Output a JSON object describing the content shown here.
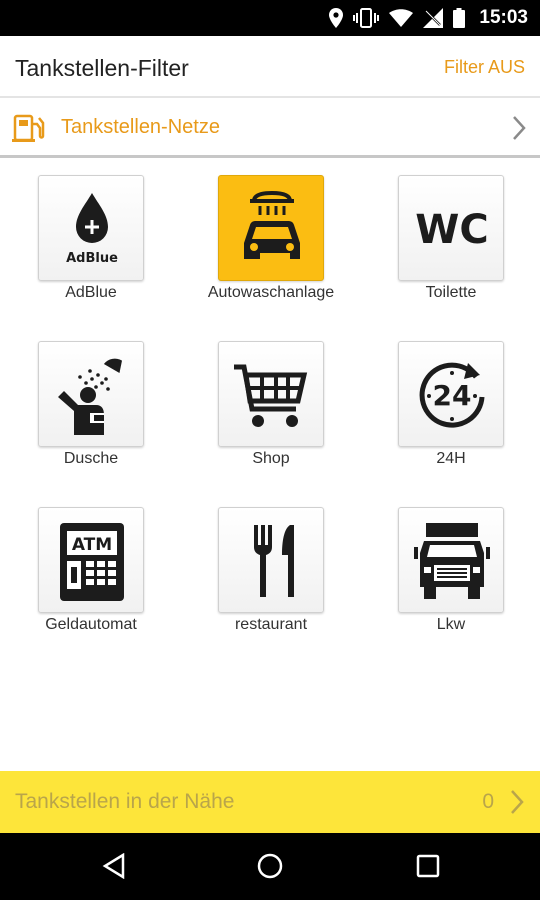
{
  "status_bar": {
    "time": "15:03",
    "icons": [
      "location-icon",
      "vibrate-icon",
      "wifi-icon",
      "no-signal-icon",
      "battery-icon"
    ]
  },
  "header": {
    "title": "Tankstellen-Filter",
    "filter_toggle": "Filter AUS"
  },
  "networks": {
    "label": "Tankstellen-Netze",
    "icon": "fuel-pump-icon"
  },
  "filters": [
    {
      "label": "AdBlue",
      "icon": "adblue-icon",
      "active": false
    },
    {
      "label": "Autowaschanlage",
      "icon": "car-wash-icon",
      "active": true
    },
    {
      "label": "Toilette",
      "icon": "wc-icon",
      "active": false
    },
    {
      "label": "Dusche",
      "icon": "shower-icon",
      "active": false
    },
    {
      "label": "Shop",
      "icon": "shopping-cart-icon",
      "active": false
    },
    {
      "label": "24H",
      "icon": "24h-icon",
      "active": false
    },
    {
      "label": "Geldautomat",
      "icon": "atm-icon",
      "active": false
    },
    {
      "label": "restaurant",
      "icon": "fork-knife-icon",
      "active": false
    },
    {
      "label": "Lkw",
      "icon": "truck-icon",
      "active": false
    }
  ],
  "adblue_icon_text": "AdBlue",
  "wc_icon_text": "WC",
  "h24_icon_text": "24",
  "atm_icon_text": "ATM",
  "nearby": {
    "label": "Tankstellen in der Nähe",
    "count": "0"
  },
  "colors": {
    "accent_orange": "#e89a1a",
    "active_tile": "#fbbd12",
    "nearby_bar": "#fde53a"
  }
}
